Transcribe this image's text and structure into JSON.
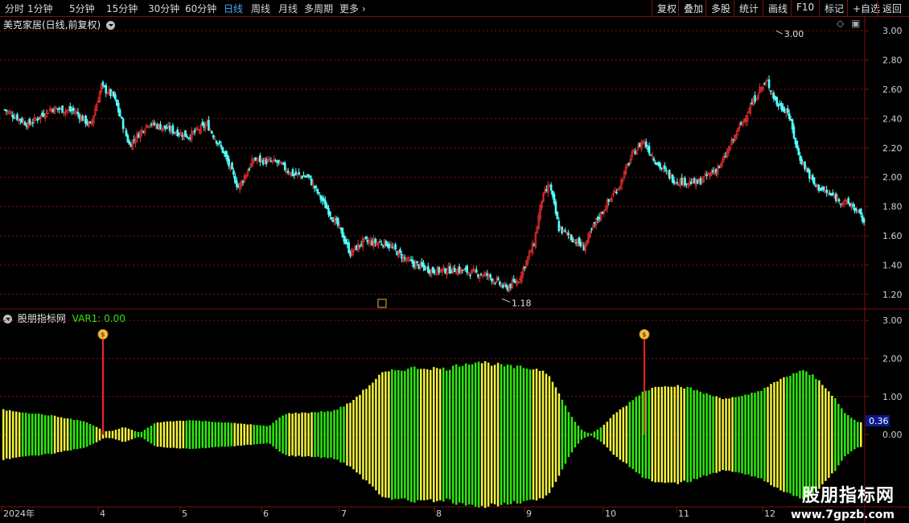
{
  "toolbar": {
    "left_items": [
      "分时",
      "1分钟",
      "5分钟",
      "15分钟",
      "30分钟",
      "60分钟",
      "日线",
      "周线",
      "月线",
      "多周期",
      "更多"
    ],
    "active_index": 6,
    "right_items": [
      "复权",
      "叠加",
      "多股",
      "统计",
      "画线",
      "F10",
      "标记",
      "+自选",
      "返回"
    ]
  },
  "main_pane": {
    "title": "美克家居(日线,前复权)",
    "high_label": "3.00",
    "low_label": "1.18",
    "y_ticks": [
      "3.00",
      "2.80",
      "2.60",
      "2.40",
      "2.20",
      "2.00",
      "1.80",
      "1.60",
      "1.40",
      "1.20"
    ]
  },
  "indicator_pane": {
    "title": "股朋指标网",
    "var_label": "VAR1: 0.00",
    "y_ticks": [
      "3.00",
      "2.00",
      "1.00",
      "0.00"
    ],
    "current_value": "0.36"
  },
  "time_axis": [
    "2024年",
    "4",
    "5",
    "6",
    "7",
    "8",
    "9",
    "10",
    "11",
    "12"
  ],
  "watermark": {
    "line1": "股朋指标网",
    "line2": "www.7gpzb.com"
  },
  "colors": {
    "up": "#e0302f",
    "down": "#54ffff",
    "bar_green": "#2ee80e",
    "bar_yellow": "#f4f43a",
    "signal": "#ff2020",
    "grid": "#7a1010"
  },
  "chart_data": [
    {
      "type": "candlestick",
      "title": "美克家居(日线,前复权)",
      "ylim": [
        1.1,
        3.1
      ],
      "x_labels": [
        "2024年",
        "4",
        "5",
        "6",
        "7",
        "8",
        "9",
        "10",
        "11",
        "12"
      ],
      "close_anchors": [
        [
          0,
          2.46
        ],
        [
          15,
          2.36
        ],
        [
          30,
          2.47
        ],
        [
          45,
          2.45
        ],
        [
          55,
          2.35
        ],
        [
          62,
          2.62
        ],
        [
          70,
          2.55
        ],
        [
          80,
          2.22
        ],
        [
          92,
          2.37
        ],
        [
          105,
          2.33
        ],
        [
          118,
          2.28
        ],
        [
          130,
          2.36
        ],
        [
          140,
          2.18
        ],
        [
          150,
          1.93
        ],
        [
          160,
          2.12
        ],
        [
          175,
          2.1
        ],
        [
          185,
          2.02
        ],
        [
          195,
          2.0
        ],
        [
          205,
          1.82
        ],
        [
          215,
          1.65
        ],
        [
          222,
          1.48
        ],
        [
          230,
          1.56
        ],
        [
          245,
          1.55
        ],
        [
          260,
          1.42
        ],
        [
          275,
          1.36
        ],
        [
          290,
          1.37
        ],
        [
          310,
          1.33
        ],
        [
          322,
          1.24
        ],
        [
          330,
          1.3
        ],
        [
          340,
          1.55
        ],
        [
          345,
          1.85
        ],
        [
          350,
          1.95
        ],
        [
          356,
          1.65
        ],
        [
          365,
          1.58
        ],
        [
          372,
          1.52
        ],
        [
          380,
          1.7
        ],
        [
          395,
          1.95
        ],
        [
          403,
          2.15
        ],
        [
          410,
          2.25
        ],
        [
          420,
          2.08
        ],
        [
          430,
          1.98
        ],
        [
          445,
          1.96
        ],
        [
          460,
          2.08
        ],
        [
          470,
          2.3
        ],
        [
          480,
          2.5
        ],
        [
          485,
          2.6
        ],
        [
          490,
          2.65
        ],
        [
          496,
          2.5
        ],
        [
          503,
          2.45
        ],
        [
          510,
          2.15
        ],
        [
          520,
          1.95
        ],
        [
          530,
          1.88
        ],
        [
          545,
          1.8
        ],
        [
          552,
          1.7
        ]
      ],
      "high_marker": 3.0,
      "low_marker": 1.18
    },
    {
      "type": "bar",
      "title": "股朋指标网",
      "series_name": "VAR1",
      "ylim": [
        -1.9,
        3.3
      ],
      "envelope": [
        [
          0,
          0.65
        ],
        [
          10,
          0.6
        ],
        [
          20,
          0.55
        ],
        [
          30,
          0.5
        ],
        [
          40,
          0.42
        ],
        [
          50,
          0.35
        ],
        [
          58,
          0.2
        ],
        [
          63,
          0.08
        ],
        [
          68,
          0.1
        ],
        [
          75,
          0.2
        ],
        [
          80,
          0.12
        ],
        [
          85,
          0.05
        ],
        [
          95,
          0.32
        ],
        [
          115,
          0.38
        ],
        [
          130,
          0.34
        ],
        [
          150,
          0.28
        ],
        [
          165,
          0.22
        ],
        [
          175,
          0.55
        ],
        [
          190,
          0.58
        ],
        [
          205,
          0.62
        ],
        [
          215,
          0.82
        ],
        [
          225,
          1.2
        ],
        [
          235,
          1.6
        ],
        [
          245,
          1.7
        ],
        [
          255,
          1.75
        ],
        [
          265,
          1.75
        ],
        [
          275,
          1.72
        ],
        [
          285,
          1.85
        ],
        [
          295,
          1.92
        ],
        [
          305,
          1.85
        ],
        [
          315,
          1.78
        ],
        [
          325,
          1.75
        ],
        [
          335,
          1.7
        ],
        [
          340,
          1.55
        ],
        [
          345,
          1.1
        ],
        [
          350,
          0.7
        ],
        [
          355,
          0.35
        ],
        [
          360,
          0.1
        ],
        [
          365,
          0.02
        ],
        [
          372,
          0.2
        ],
        [
          380,
          0.55
        ],
        [
          388,
          0.8
        ],
        [
          398,
          1.15
        ],
        [
          410,
          1.3
        ],
        [
          420,
          1.28
        ],
        [
          428,
          1.2
        ],
        [
          438,
          1.05
        ],
        [
          448,
          0.95
        ],
        [
          458,
          0.98
        ],
        [
          468,
          1.12
        ],
        [
          478,
          1.32
        ],
        [
          488,
          1.55
        ],
        [
          496,
          1.68
        ],
        [
          503,
          1.55
        ],
        [
          510,
          1.3
        ],
        [
          517,
          0.95
        ],
        [
          522,
          0.6
        ],
        [
          530,
          0.35
        ],
        [
          535,
          0.3
        ]
      ],
      "signal_markers": [
        {
          "x": "4",
          "value": 2.55
        },
        {
          "x": "10",
          "value": 2.55
        }
      ]
    }
  ]
}
